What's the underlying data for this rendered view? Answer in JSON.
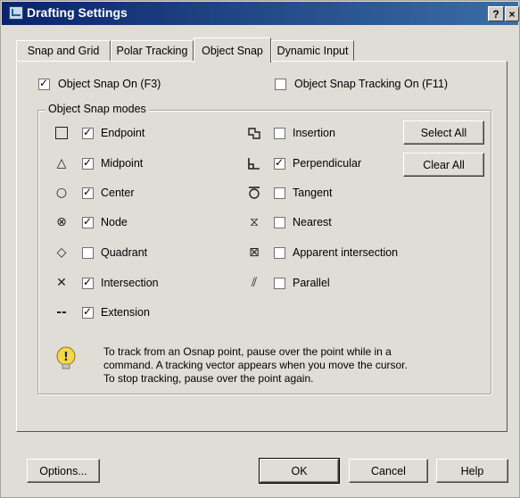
{
  "window": {
    "title": "Drafting Settings",
    "help_label": "?",
    "close_label": "×"
  },
  "tabs": [
    {
      "label": "Snap and Grid"
    },
    {
      "label": "Polar Tracking"
    },
    {
      "label": "Object Snap"
    },
    {
      "label": "Dynamic Input"
    }
  ],
  "active_tab": "Object Snap",
  "options": {
    "snap_on": {
      "label": "Object Snap On (F3)",
      "checked": true
    },
    "tracking_on": {
      "label": "Object Snap Tracking On (F11)",
      "checked": false
    }
  },
  "modes_group": {
    "title": "Object Snap modes",
    "left": [
      {
        "label": "Endpoint",
        "marker": "□",
        "checked": true
      },
      {
        "label": "Midpoint",
        "marker": "△",
        "checked": true
      },
      {
        "label": "Center",
        "marker": "○",
        "checked": true
      },
      {
        "label": "Node",
        "marker": "⊗",
        "checked": true
      },
      {
        "label": "Quadrant",
        "marker": "◇",
        "checked": false
      },
      {
        "label": "Intersection",
        "marker": "✕",
        "checked": true
      },
      {
        "label": "Extension",
        "marker": "--",
        "checked": true
      }
    ],
    "right": [
      {
        "label": "Insertion",
        "marker": "insertion-marker-icon",
        "checked": false
      },
      {
        "label": "Perpendicular",
        "marker": "perpendicular-marker-icon",
        "checked": true
      },
      {
        "label": "Tangent",
        "marker": "tangent-marker-icon",
        "checked": false
      },
      {
        "label": "Nearest",
        "marker": "⧖",
        "checked": false
      },
      {
        "label": "Apparent intersection",
        "marker": "⊠",
        "checked": false
      },
      {
        "label": "Parallel",
        "marker": "⫽",
        "checked": false
      }
    ],
    "select_all_label": "Select All",
    "clear_all_label": "Clear All"
  },
  "info": {
    "lines": [
      "To track from an Osnap point, pause over the point while in a",
      "command.  A tracking vector appears when you move the cursor.",
      "To stop tracking, pause over the point again."
    ]
  },
  "footer": {
    "options_label": "Options...",
    "ok_label": "OK",
    "cancel_label": "Cancel",
    "help_label": "Help"
  },
  "colors": {
    "titlebar": "#0a246a",
    "dialog_bg": "#e0ddd6",
    "info_icon": "#f0d040"
  }
}
